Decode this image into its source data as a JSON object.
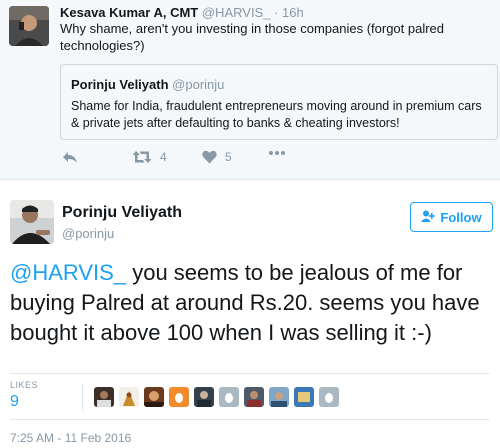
{
  "reply_tweet": {
    "author_name": "Kesava Kumar A, CMT",
    "author_handle": "@HARVIS_",
    "separator": "·",
    "time": "16h",
    "text": "Why shame, aren't you investing in those companies (forgot palred technologies?)",
    "quoted": {
      "author_name": "Porinju Veliyath",
      "author_handle": "@porinju",
      "text": "Shame for India, fraudulent entrepreneurs moving around in premium cars & private jets after defaulting to banks & cheating investors!"
    },
    "actions": {
      "reply_icon": "reply-arrow-icon",
      "retweet_icon": "retweet-icon",
      "retweet_count": "4",
      "like_icon": "heart-icon",
      "like_count": "5",
      "more_icon": "more-dots-icon"
    }
  },
  "main_tweet": {
    "author_name": "Porinju Veliyath",
    "author_handle": "@porinju",
    "follow_label": "Follow",
    "follow_icon": "add-user-icon",
    "mention": "@HARVIS_",
    "text_rest": " you seems to be jealous of me for buying Palred at around Rs.20. seems you have bought it above 100 when I was selling it :-)",
    "likes_label": "LIKES",
    "likes_count": "9",
    "liker_avatar_count": 10,
    "timestamp": "7:25 AM - 11 Feb 2016"
  },
  "colors": {
    "accent": "#1da1f2",
    "muted": "#8899a6",
    "text": "#14171a",
    "reply_bg": "#f5f8fa",
    "border": "#e1e8ed"
  }
}
